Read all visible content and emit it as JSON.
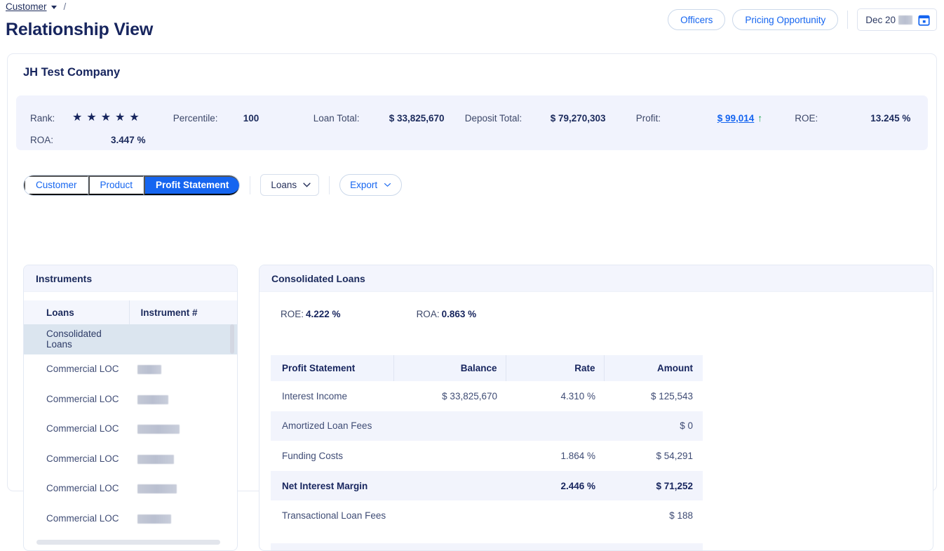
{
  "breadcrumb": {
    "root": "Customer",
    "separator": "/"
  },
  "header": {
    "title": "Relationship View",
    "officers_label": "Officers",
    "pricing_label": "Pricing Opportunity",
    "date_value": "Dec 20",
    "date_redacted": true,
    "calendar_icon": "calendar-icon"
  },
  "company": {
    "name": "JH Test Company"
  },
  "summary": {
    "rank_label": "Rank:",
    "rank_stars": 5,
    "percentile_label": "Percentile:",
    "percentile_value": "100",
    "loan_total_label": "Loan Total:",
    "loan_total_value": "$ 33,825,670",
    "deposit_total_label": "Deposit Total:",
    "deposit_total_value": "$ 79,270,303",
    "profit_label": "Profit:",
    "profit_value": "$ 99,014",
    "profit_trend": "up",
    "roe_label": "ROE:",
    "roe_value": "13.245 %",
    "roa_label": "ROA:",
    "roa_value": "3.447 %"
  },
  "tabs": {
    "items": [
      {
        "label": "Customer",
        "active": false
      },
      {
        "label": "Product",
        "active": false
      },
      {
        "label": "Profit Statement",
        "active": true
      }
    ],
    "loans_dropdown": "Loans",
    "export_button": "Export"
  },
  "instruments_panel": {
    "title": "Instruments",
    "columns": [
      "Loans",
      "Instrument #"
    ],
    "rows": [
      {
        "name": "Consolidated Loans",
        "instrument": "",
        "selected": true,
        "redact_width": 0
      },
      {
        "name": "Commercial LOC",
        "instrument": "",
        "selected": false,
        "redact_width": 34
      },
      {
        "name": "Commercial LOC",
        "instrument": "",
        "selected": false,
        "redact_width": 44
      },
      {
        "name": "Commercial LOC",
        "instrument": "",
        "selected": false,
        "redact_width": 60
      },
      {
        "name": "Commercial LOC",
        "instrument": "",
        "selected": false,
        "redact_width": 52
      },
      {
        "name": "Commercial LOC",
        "instrument": "",
        "selected": false,
        "redact_width": 56
      },
      {
        "name": "Commercial LOC",
        "instrument": "",
        "selected": false,
        "redact_width": 48
      }
    ]
  },
  "consolidated_panel": {
    "title": "Consolidated Loans",
    "roe_label": "ROE:",
    "roe_value": "4.222 %",
    "roa_label": "ROA:",
    "roa_value": "0.863 %",
    "columns": [
      "Profit Statement",
      "Balance",
      "Rate",
      "Amount"
    ],
    "rows": [
      {
        "name": "Interest Income",
        "balance": "$ 33,825,670",
        "rate": "4.310 %",
        "amount": "$ 125,543",
        "bold": false
      },
      {
        "name": "Amortized Loan Fees",
        "balance": "",
        "rate": "",
        "amount": "$ 0",
        "bold": false
      },
      {
        "name": "Funding Costs",
        "balance": "",
        "rate": "1.864 %",
        "amount": "$ 54,291",
        "bold": false
      },
      {
        "name": "Net Interest Margin",
        "balance": "",
        "rate": "2.446 %",
        "amount": "$ 71,252",
        "bold": true
      },
      {
        "name": "Transactional Loan Fees",
        "balance": "",
        "rate": "",
        "amount": "$ 188",
        "bold": false
      }
    ]
  },
  "colors": {
    "accent_blue": "#1565f0",
    "navy": "#17255e",
    "summary_bg": "#f1f3fd",
    "selected_row": "#dbe5ef",
    "alt_row": "#f2f4fc",
    "trend_up": "#22a85a"
  }
}
